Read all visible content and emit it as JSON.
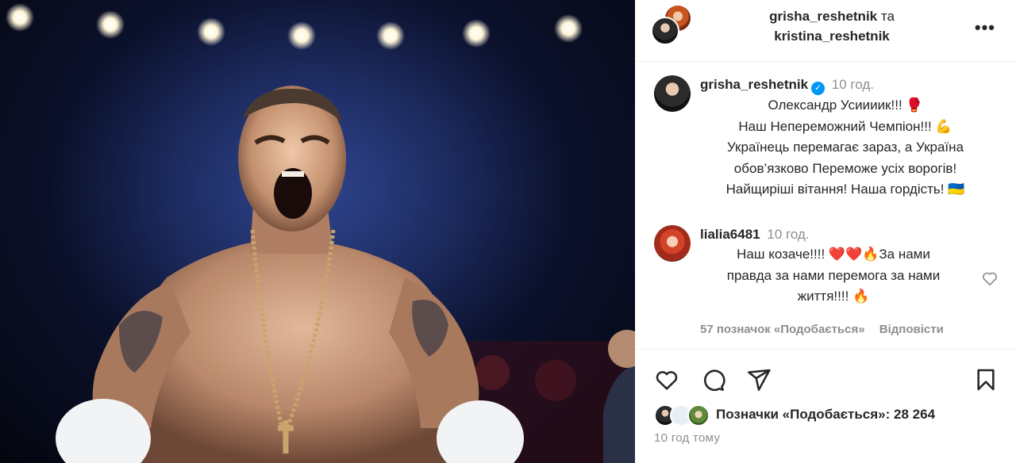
{
  "post": {
    "image_alt": "Boxer celebrating in the ring",
    "authors": {
      "primary": "grisha_reshetnik",
      "conjunction": "та",
      "secondary": "kristina_reshetnik"
    },
    "more_icon": "more-horizontal-icon"
  },
  "caption": {
    "username": "grisha_reshetnik",
    "verified": true,
    "time": "10 год.",
    "lines": [
      "Олександр Усиииик!!! 🥊",
      "Наш Непереможний Чемпіон!!! 💪",
      "Українець перемагає зараз, а Україна",
      "обов’язково Переможе усіх ворогів!",
      "Найщиріші вітання! Наша гордість! 🇺🇦"
    ]
  },
  "comment": {
    "username": "lialia6481",
    "time": "10 год.",
    "lines": [
      "Наш козаче!!!! ❤️❤️🔥За нами",
      "правда за нами перемога за нами",
      "життя!!!! 🔥"
    ],
    "likes": "57 позначок «Подобається»",
    "reply": "Відповісти"
  },
  "actions": {
    "like_icon": "heart-icon",
    "comment_icon": "comment-icon",
    "share_icon": "send-icon",
    "save_icon": "bookmark-icon"
  },
  "likes": {
    "text": "Позначки «Подобається»: 28 264"
  },
  "timestamp": "10 год тому",
  "colors": {
    "verified": "#0095f6",
    "muted": "#8e8e8e",
    "text": "#262626"
  }
}
